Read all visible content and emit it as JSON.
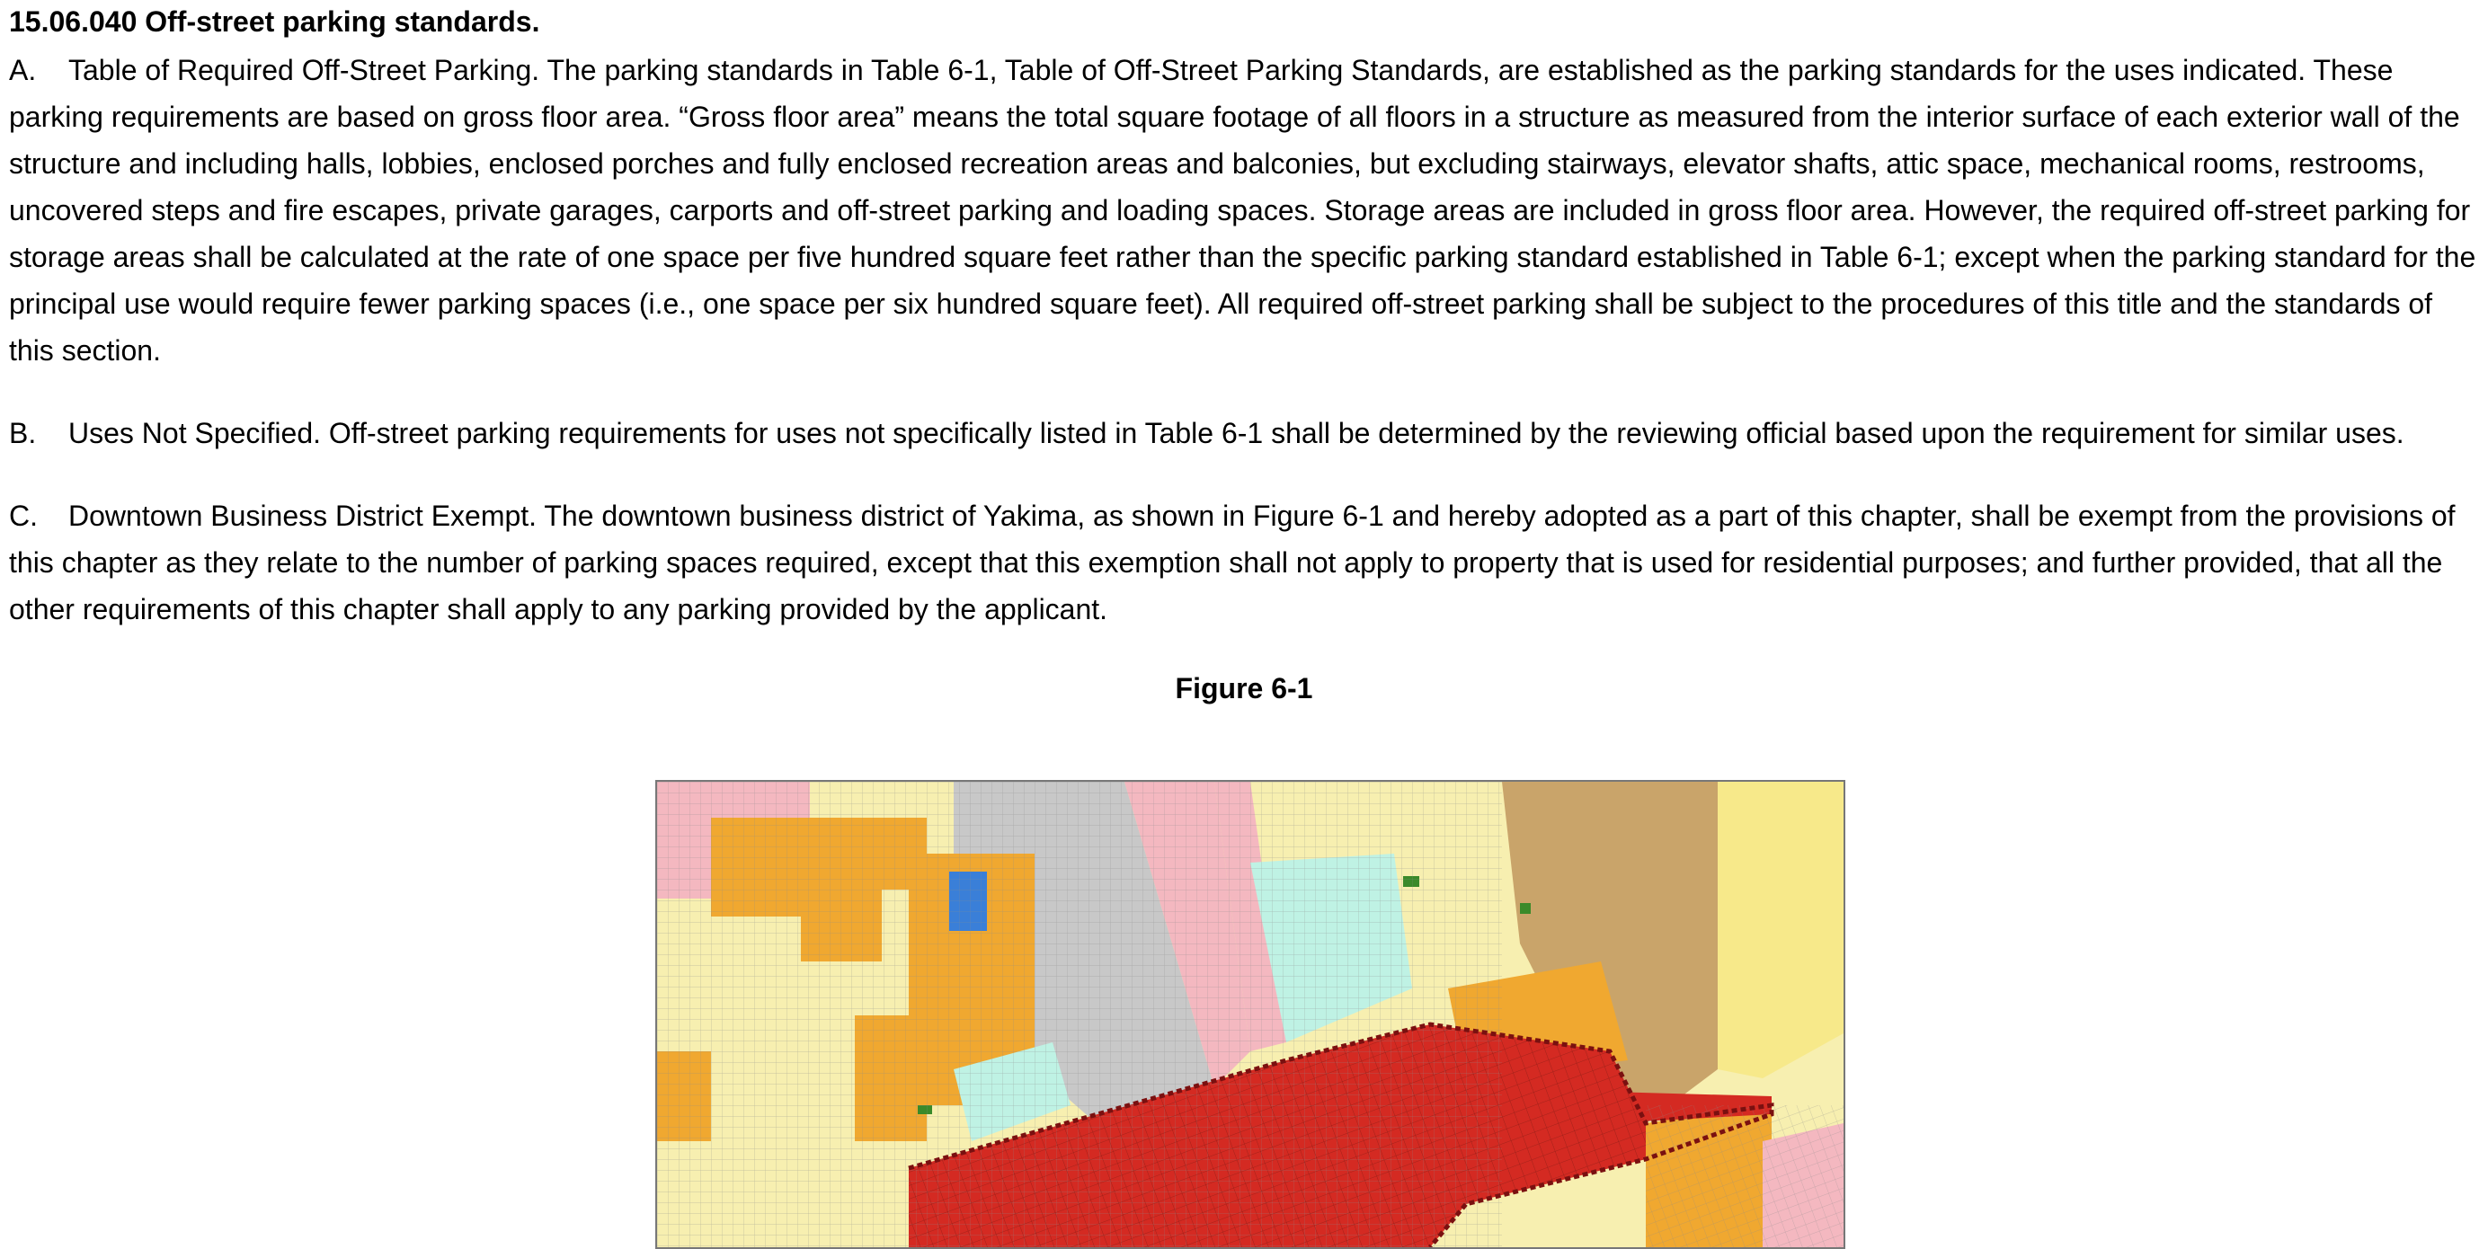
{
  "section": {
    "heading": "15.06.040 Off-street parking standards."
  },
  "paragraphs": [
    {
      "marker": "A.",
      "text": "Table of Required Off-Street Parking. The parking standards in Table 6-1, Table of Off-Street Parking Standards, are established as the parking standards for the uses indicated. These parking requirements are based on gross floor area. “Gross floor area” means the total square footage of all floors in a structure as measured from the interior surface of each exterior wall of the structure and including halls, lobbies, enclosed porches and fully enclosed recreation areas and balconies, but excluding stairways, elevator shafts, attic space, mechanical rooms, restrooms, uncovered steps and fire escapes, private garages, carports and off-street parking and loading spaces. Storage areas are included in gross floor area. However, the required off-street parking for storage areas shall be calculated at the rate of one space per five hundred square feet rather than the specific parking standard established in Table 6-1; except when the parking standard for the principal use would require fewer parking spaces (i.e., one space per six hundred square feet). All required off-street parking shall be subject to the procedures of this title and the standards of this section."
    },
    {
      "marker": "B.",
      "text": "Uses Not Specified. Off-street parking requirements for uses not specifically listed in Table 6-1 shall be determined by the reviewing official based upon the requirement for similar uses."
    },
    {
      "marker": "C.",
      "text": "Downtown Business District Exempt. The downtown business district of Yakima, as shown in Figure 6-1 and hereby adopted as a part of this chapter, shall be exempt from the provisions of this chapter as they relate to the number of parking spaces required, except that this exemption shall not apply to property that is used for residential purposes; and further provided, that all the other requirements of this chapter shall apply to any parking provided by the applicant."
    }
  ],
  "figure": {
    "caption": "Figure 6-1",
    "map_colors": {
      "residential_light": "#f7efb0",
      "residential_orange": "#f0a830",
      "commercial_pink": "#f4b8c0",
      "industrial_gray": "#c8c8c8",
      "downtown_red": "#d42a22",
      "mixed_teal": "#bff2e4",
      "institutional_tan": "#c9a46a",
      "park_blue": "#3a7fd8",
      "park_green": "#3a8a2a",
      "boundary_dashed": "#7a1010"
    }
  }
}
